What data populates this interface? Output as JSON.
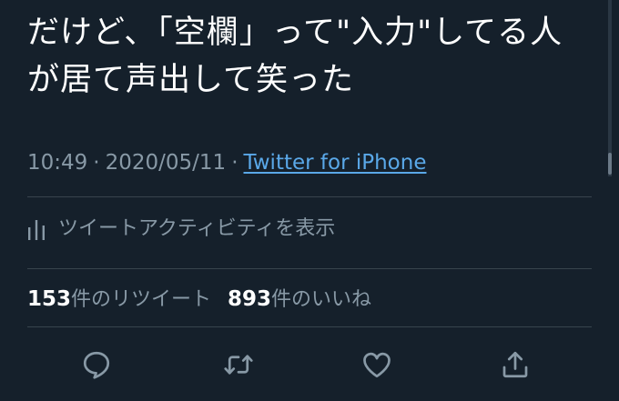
{
  "tweet": {
    "text_lines": [
      "だけど、「空欄」って\"入力\"してる人",
      "が居て声出して笑った"
    ],
    "time": "10:49",
    "separator": "·",
    "date": "2020/05/11",
    "source": "Twitter for iPhone"
  },
  "activity": {
    "label": "ツイートアクティビティを表示",
    "icon": "analytics-bars-icon"
  },
  "stats": {
    "retweets": {
      "count": "153",
      "label": "件のリツイート"
    },
    "likes": {
      "count": "893",
      "label": "件のいいね"
    }
  },
  "actions": [
    {
      "name": "reply",
      "icon": "reply-bubble-icon"
    },
    {
      "name": "retweet",
      "icon": "retweet-arrows-icon"
    },
    {
      "name": "like",
      "icon": "heart-icon"
    },
    {
      "name": "share",
      "icon": "share-upload-icon"
    }
  ],
  "colors": {
    "background": "#15202b",
    "text_primary": "#ffffff",
    "text_secondary": "#8899a6",
    "link": "#5aa8e8",
    "divider": "#38444d"
  }
}
